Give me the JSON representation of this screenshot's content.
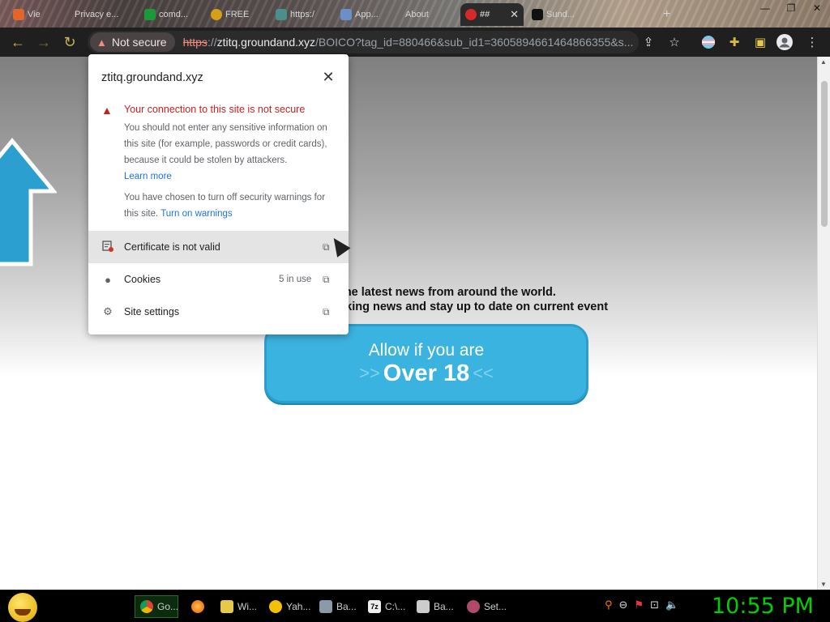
{
  "browser": {
    "tabs": [
      {
        "label": "Vie"
      },
      {
        "label": "Privacy e..."
      },
      {
        "label": "comd..."
      },
      {
        "label": "FREE"
      },
      {
        "label": "https:/"
      },
      {
        "label": "App..."
      },
      {
        "label": "About"
      },
      {
        "label": "##"
      },
      {
        "label": "Sund..."
      }
    ],
    "new_tab": "+",
    "omnibox": {
      "security_chip": "Not secure",
      "url_scheme": "https",
      "url_sep": "://",
      "url_host": "ztitq.groundand.xyz",
      "url_rest": "/BOICO?tag_id=880466&sub_id1=3605894661464866355&s..."
    }
  },
  "site_info_popup": {
    "host": "ztitq.groundand.xyz",
    "warning_title": "Your connection to this site is not secure",
    "warning_body": "You should not enter any sensitive information on this site (for example, passwords or credit cards), because it could be stolen by attackers.",
    "learn_more": "Learn more",
    "warnings_off_text": "You have chosen to turn off security warnings for this site.",
    "turn_on_warnings": "Turn on warnings",
    "rows": [
      {
        "label": "Certificate is not valid",
        "meta": ""
      },
      {
        "label": "Cookies",
        "meta": "5 in use"
      },
      {
        "label": "Site settings",
        "meta": ""
      }
    ]
  },
  "page": {
    "news_line1": "the latest news from around the world.",
    "news_line2": "eaking news and stay up to date on current event",
    "cta_line1": "Allow if you are",
    "cta_line2": "Over 18",
    "cta_chevron_left": ">>",
    "cta_chevron_right": "<<"
  },
  "taskbar": {
    "buttons": [
      {
        "label": "Go..."
      },
      {
        "label": ""
      },
      {
        "label": "Wi..."
      },
      {
        "label": "Yah..."
      },
      {
        "label": "Ba..."
      },
      {
        "label": "C:\\..."
      },
      {
        "label": "Ba..."
      },
      {
        "label": "Set..."
      }
    ],
    "clock": "10:55 PM"
  },
  "colors": {
    "security_red": "#c5221f",
    "link_blue": "#1a73e8",
    "cta_blue": "#3bb3e0",
    "clock_green": "#00d000"
  }
}
